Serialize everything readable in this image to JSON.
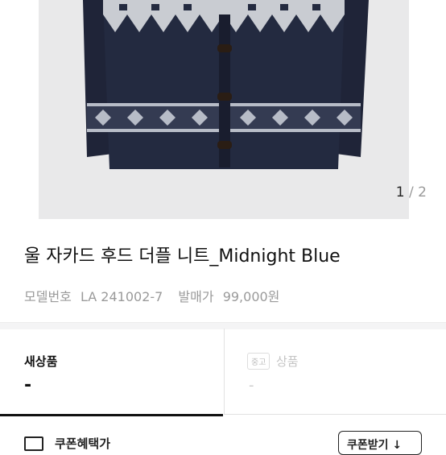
{
  "gallery": {
    "current": "1",
    "separator": "/",
    "total": "2"
  },
  "product": {
    "title": "울 자카드 후드 더플 니트_Midnight Blue",
    "model_label": "모델번호",
    "model_number": "LA 241002-7",
    "price_label": "발매가",
    "price": "99,000원"
  },
  "condition": {
    "new_label": "새상품",
    "new_value": "-",
    "used_badge": "중고",
    "used_label": "상품",
    "used_value": "-"
  },
  "coupon": {
    "label": "쿠폰혜택가",
    "button_label": "쿠폰받기 ↓"
  }
}
